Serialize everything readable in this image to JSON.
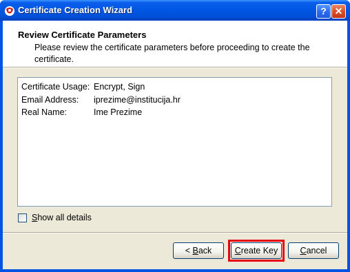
{
  "window": {
    "title": "Certificate Creation Wizard",
    "help_symbol": "?",
    "close_symbol": "✕"
  },
  "header": {
    "title": "Review Certificate Parameters",
    "description": "Please review the certificate parameters before proceeding to create the certificate."
  },
  "parameters": [
    {
      "label": "Certificate Usage:",
      "value": "Encrypt, Sign"
    },
    {
      "label": "Email Address:",
      "value": "iprezime@institucija.hr"
    },
    {
      "label": "Real Name:",
      "value": "Ime Prezime"
    }
  ],
  "show_details": {
    "label_underlined": "S",
    "label_rest": "how all details",
    "checked": false
  },
  "buttons": {
    "back_prefix": "< ",
    "back_underlined": "B",
    "back_rest": "ack",
    "create_underlined": "C",
    "create_rest": "reate Key",
    "cancel_underlined": "C",
    "cancel_rest": "ancel"
  },
  "colors": {
    "highlight": "#e8000f",
    "titlebar": "#0058e6"
  }
}
